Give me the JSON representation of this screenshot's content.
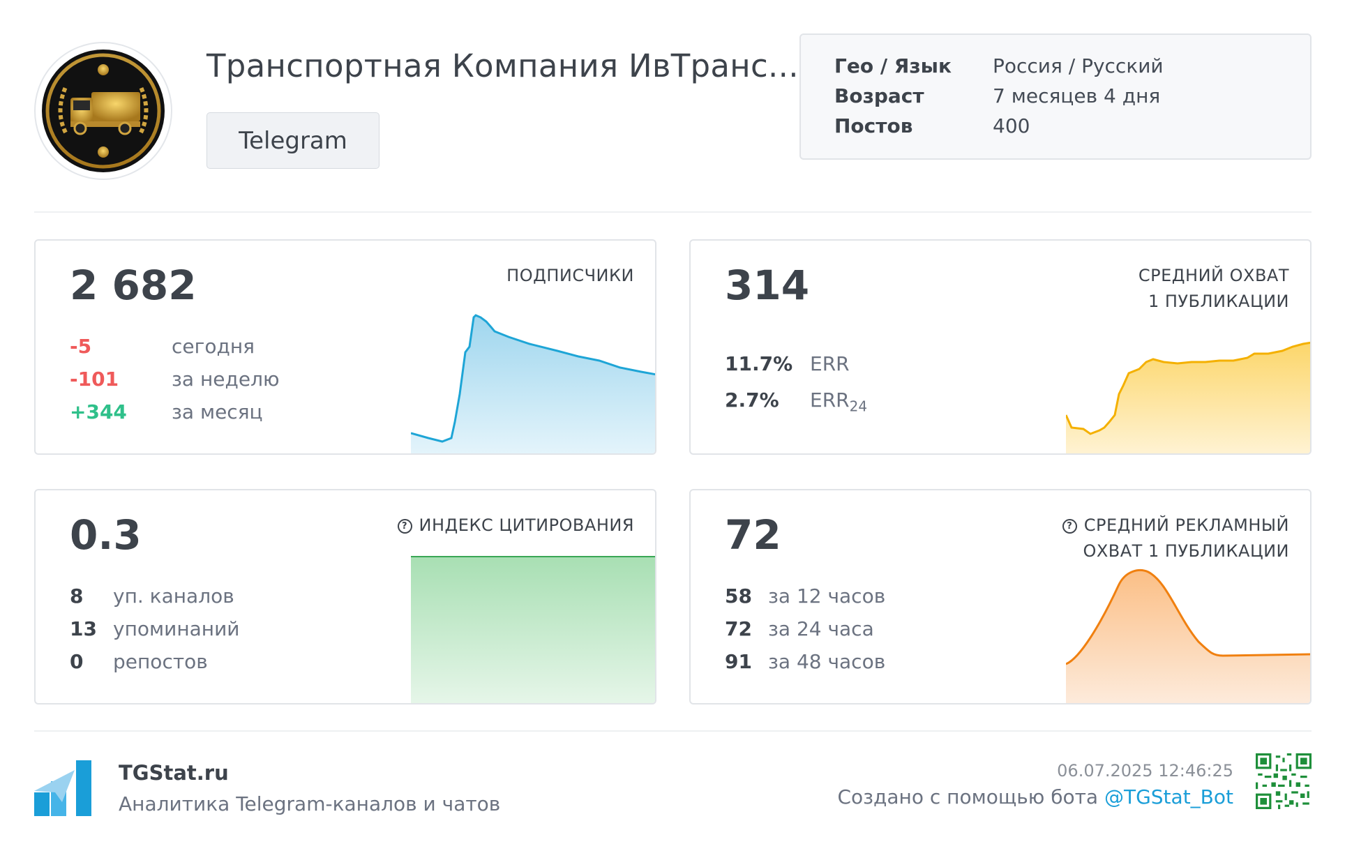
{
  "header": {
    "channel_title": "Транспортная Компания ИвТранс...",
    "platform": "Telegram",
    "info": [
      {
        "label": "Гео / Язык",
        "value": "Россия / Русский"
      },
      {
        "label": "Возраст",
        "value": "7 месяцев 4 дня"
      },
      {
        "label": "Постов",
        "value": "400"
      }
    ]
  },
  "cards": {
    "subscribers": {
      "value": "2 682",
      "label": "ПОДПИСЧИКИ",
      "stats": [
        {
          "value": "-5",
          "text": "сегодня"
        },
        {
          "value": "-101",
          "text": "за неделю"
        },
        {
          "value": "+344",
          "text": "за месяц"
        }
      ]
    },
    "reach": {
      "value": "314",
      "label_line1": "СРЕДНИЙ ОХВАТ",
      "label_line2": "1 ПУБЛИКАЦИИ",
      "stats": [
        {
          "value": "11.7%",
          "text": "ERR"
        },
        {
          "value": "2.7%",
          "text": "ERR",
          "sub": "24"
        }
      ]
    },
    "citation": {
      "value": "0.3",
      "label": "ИНДЕКС ЦИТИРОВАНИЯ",
      "stats": [
        {
          "value": "8",
          "text": "уп. каналов"
        },
        {
          "value": "13",
          "text": "упоминаний"
        },
        {
          "value": "0",
          "text": "репостов"
        }
      ]
    },
    "ad_reach": {
      "value": "72",
      "label_line1": "СРЕДНИЙ РЕКЛАМНЫЙ",
      "label_line2": "ОХВАТ 1 ПУБЛИКАЦИИ",
      "stats": [
        {
          "value": "58",
          "text": "за 12 часов"
        },
        {
          "value": "72",
          "text": "за 24 часа"
        },
        {
          "value": "91",
          "text": "за 48 часов"
        }
      ]
    }
  },
  "footer": {
    "site": "TGStat.ru",
    "tagline": "Аналитика Telegram-каналов и чатов",
    "date": "06.07.2025 12:46:25",
    "credit_text": "Создано с помощью бота ",
    "bot_handle": "@TGStat_Bot"
  },
  "colors": {
    "negative": "#ef5a5a",
    "positive": "#2fc08a",
    "subscribers_line": "#1ea5d6",
    "reach_line": "#f4b000",
    "citation_line": "#3aa655",
    "ad_reach_line": "#f08010",
    "brand": "#1a9ed8"
  },
  "icons": {
    "help": "question-circle-icon",
    "logo": "tgstat-logo-icon",
    "qr": "qr-code"
  }
}
